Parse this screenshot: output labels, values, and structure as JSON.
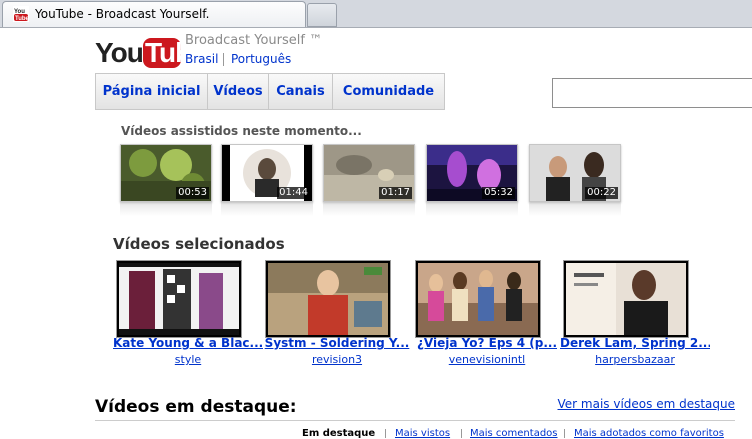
{
  "browser": {
    "tab_title": "YouTube - Broadcast Yourself."
  },
  "header": {
    "logo_you": "You",
    "logo_tube": "Tube",
    "slogan": "Broadcast Yourself ™",
    "country": "Brasil",
    "language": "Português"
  },
  "nav": {
    "items": [
      "Página inicial",
      "Vídeos",
      "Canais",
      "Comunidade"
    ]
  },
  "search": {
    "value": ""
  },
  "watching_now": {
    "title": "Vídeos assistidos neste momento...",
    "durations": [
      "00:53",
      "01:44",
      "01:17",
      "05:32",
      "00:22"
    ]
  },
  "selected": {
    "title": "Vídeos selecionados",
    "videos": [
      {
        "title": "Kate Young & a Blac...",
        "user": "style"
      },
      {
        "title": "Systm - Soldering Y...",
        "user": "revision3"
      },
      {
        "title": "¿Vieja Yo? Eps 4 (p...",
        "user": "venevisionintl"
      },
      {
        "title": "Derek Lam, Spring 2...",
        "user": "harpersbazaar"
      }
    ]
  },
  "featured": {
    "title": "Vídeos em destaque:",
    "more_link": "Ver mais vídeos em destaque",
    "tabs": [
      "Em destaque",
      "Mais vistos",
      "Mais comentados",
      "Mais adotados como favoritos"
    ]
  },
  "colors": {
    "link": "#0033cc",
    "brand_red": "#cc181e"
  }
}
